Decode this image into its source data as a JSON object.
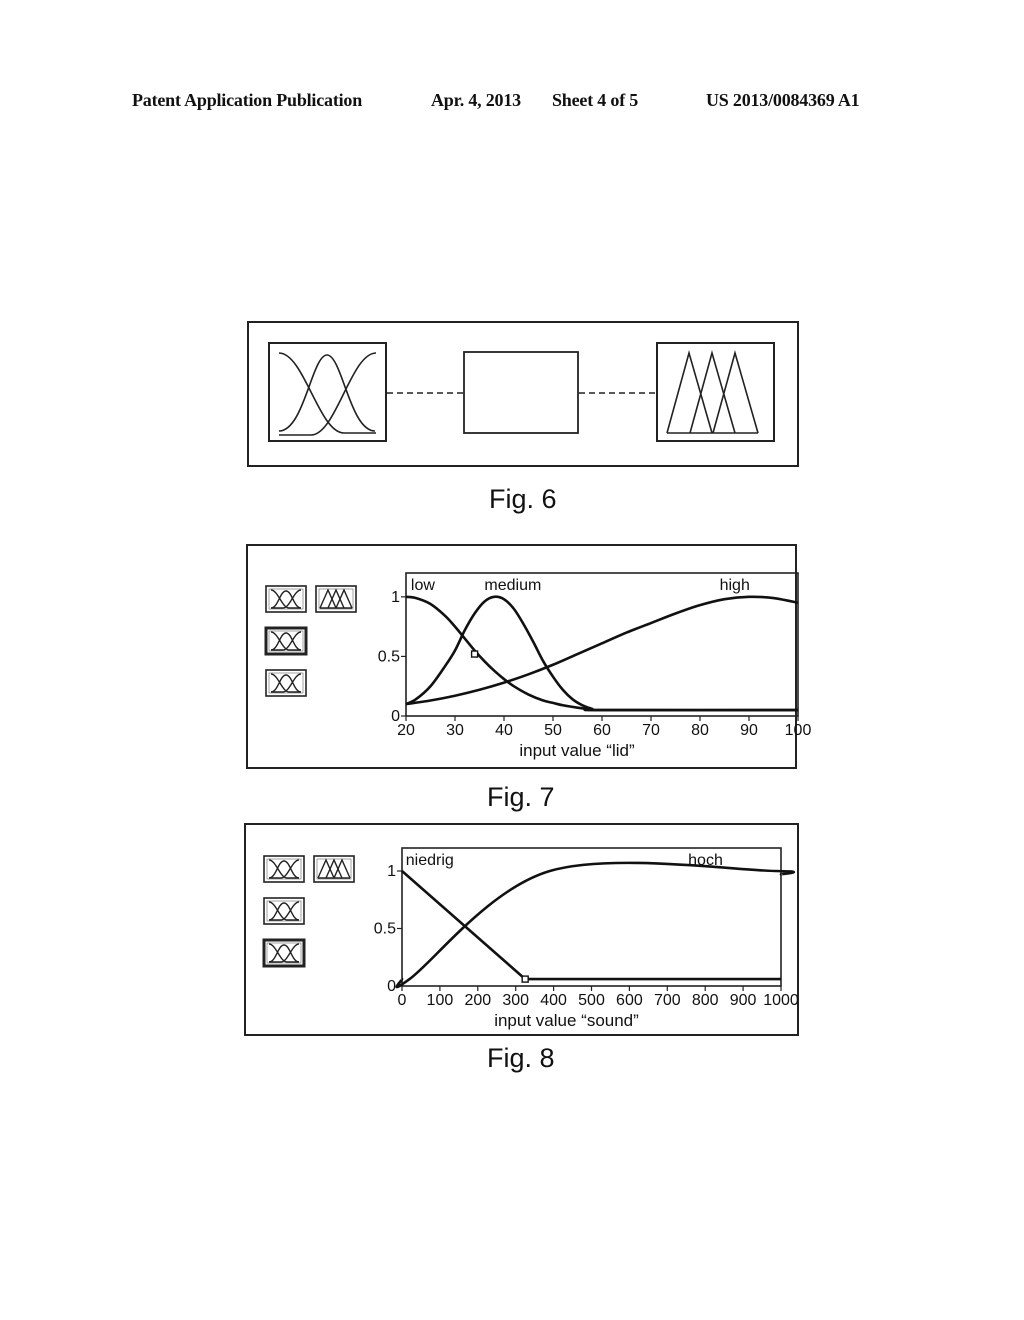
{
  "header": {
    "publication": "Patent Application Publication",
    "date": "Apr. 4, 2013",
    "sheet": "Sheet 4 of 5",
    "number": "US 2013/0084369 A1"
  },
  "fig6": {
    "caption": "Fig. 6",
    "blocks": [
      {
        "name": "input-fuzzification-block",
        "icon": "gaussian-membership-functions-icon"
      },
      {
        "name": "rule-inference-block",
        "icon": "empty-box"
      },
      {
        "name": "output-defuzzification-block",
        "icon": "triangular-membership-functions-icon"
      }
    ],
    "connectors": "dashed-line"
  },
  "fig7": {
    "caption": "Fig. 7",
    "side_icons": [
      {
        "name": "input-mf-icon-1",
        "icon": "gaussian-membership-functions-icon",
        "highlighted": false
      },
      {
        "name": "output-mf-icon",
        "icon": "triangular-membership-functions-icon",
        "highlighted": false
      },
      {
        "name": "input-mf-icon-2",
        "icon": "gaussian-membership-functions-icon",
        "highlighted": true
      },
      {
        "name": "input-mf-icon-3",
        "icon": "gaussian-membership-functions-icon",
        "highlighted": false
      }
    ]
  },
  "fig8": {
    "caption": "Fig. 8",
    "side_icons": [
      {
        "name": "input-mf-icon-1",
        "icon": "gaussian-membership-functions-icon",
        "highlighted": false
      },
      {
        "name": "output-mf-icon",
        "icon": "triangular-membership-functions-icon",
        "highlighted": false
      },
      {
        "name": "input-mf-icon-2",
        "icon": "gaussian-membership-functions-icon",
        "highlighted": false
      },
      {
        "name": "input-mf-icon-3",
        "icon": "gaussian-membership-functions-icon",
        "highlighted": true
      }
    ]
  },
  "chart_data": [
    {
      "id": "fig7",
      "type": "line",
      "title": "",
      "xlabel": "input value “lid”",
      "ylabel": "",
      "xlim": [
        20,
        100
      ],
      "ylim": [
        0,
        1.2
      ],
      "xticks": [
        20,
        30,
        40,
        50,
        60,
        70,
        80,
        90,
        100
      ],
      "xtick_labels": [
        "20",
        "30",
        "40",
        "50",
        "60",
        "70",
        "80",
        "90",
        "100"
      ],
      "yticks": [
        0,
        0.5,
        1
      ],
      "ytick_labels": [
        "0",
        "0.5",
        "1"
      ],
      "grid": false,
      "series": [
        {
          "name": "low",
          "label_x": 21,
          "x": [
            20,
            22,
            25,
            28,
            30,
            32,
            34,
            36,
            38,
            40,
            42,
            45,
            48,
            50,
            52,
            55,
            58,
            60,
            100
          ],
          "y": [
            1.0,
            0.99,
            0.94,
            0.84,
            0.75,
            0.65,
            0.55,
            0.46,
            0.38,
            0.31,
            0.25,
            0.18,
            0.13,
            0.11,
            0.09,
            0.07,
            0.055,
            0.05,
            0.05
          ]
        },
        {
          "name": "medium",
          "label_x": 36,
          "x": [
            20,
            22,
            25,
            28,
            30,
            32,
            34,
            36,
            38,
            40,
            42,
            44,
            46,
            48,
            50,
            52,
            54,
            56,
            58,
            60,
            100
          ],
          "y": [
            0.1,
            0.14,
            0.25,
            0.42,
            0.55,
            0.72,
            0.86,
            0.96,
            1.0,
            0.98,
            0.9,
            0.77,
            0.62,
            0.46,
            0.33,
            0.22,
            0.14,
            0.09,
            0.06,
            0.05,
            0.05
          ]
        },
        {
          "name": "high",
          "label_x": 84,
          "x": [
            20,
            25,
            30,
            35,
            40,
            45,
            50,
            55,
            60,
            65,
            70,
            75,
            80,
            85,
            90,
            95,
            100
          ],
          "y": [
            0.1,
            0.13,
            0.17,
            0.22,
            0.28,
            0.35,
            0.43,
            0.52,
            0.61,
            0.7,
            0.78,
            0.86,
            0.93,
            0.98,
            1.0,
            0.99,
            0.95
          ]
        }
      ],
      "markers": [
        {
          "x": 34,
          "y": 0.52,
          "shape": "square"
        }
      ]
    },
    {
      "id": "fig8",
      "type": "line",
      "title": "",
      "xlabel": "input value “sound”",
      "ylabel": "",
      "xlim": [
        0,
        1000
      ],
      "ylim": [
        0,
        1.2
      ],
      "xticks": [
        0,
        100,
        200,
        300,
        400,
        500,
        600,
        700,
        800,
        900,
        1000
      ],
      "xtick_labels": [
        "0",
        "100",
        "200",
        "300",
        "400",
        "500",
        "600",
        "700",
        "800",
        "900",
        "1000"
      ],
      "yticks": [
        0,
        0.5,
        1
      ],
      "ytick_labels": [
        "0",
        "0.5",
        "1"
      ],
      "grid": false,
      "series": [
        {
          "name": "niedrig",
          "label_x": 10,
          "x": [
            0,
            325,
            1000
          ],
          "y": [
            1.0,
            0.06,
            0.06
          ]
        },
        {
          "name": "hoch",
          "label_x": 755,
          "x": [
            0,
            20,
            390,
            985,
            1000
          ],
          "y": [
            0.06,
            0.06,
            1.0,
            1.0,
            0.97
          ]
        }
      ],
      "markers": [
        {
          "x": 325,
          "y": 0.06,
          "shape": "square"
        }
      ]
    }
  ]
}
